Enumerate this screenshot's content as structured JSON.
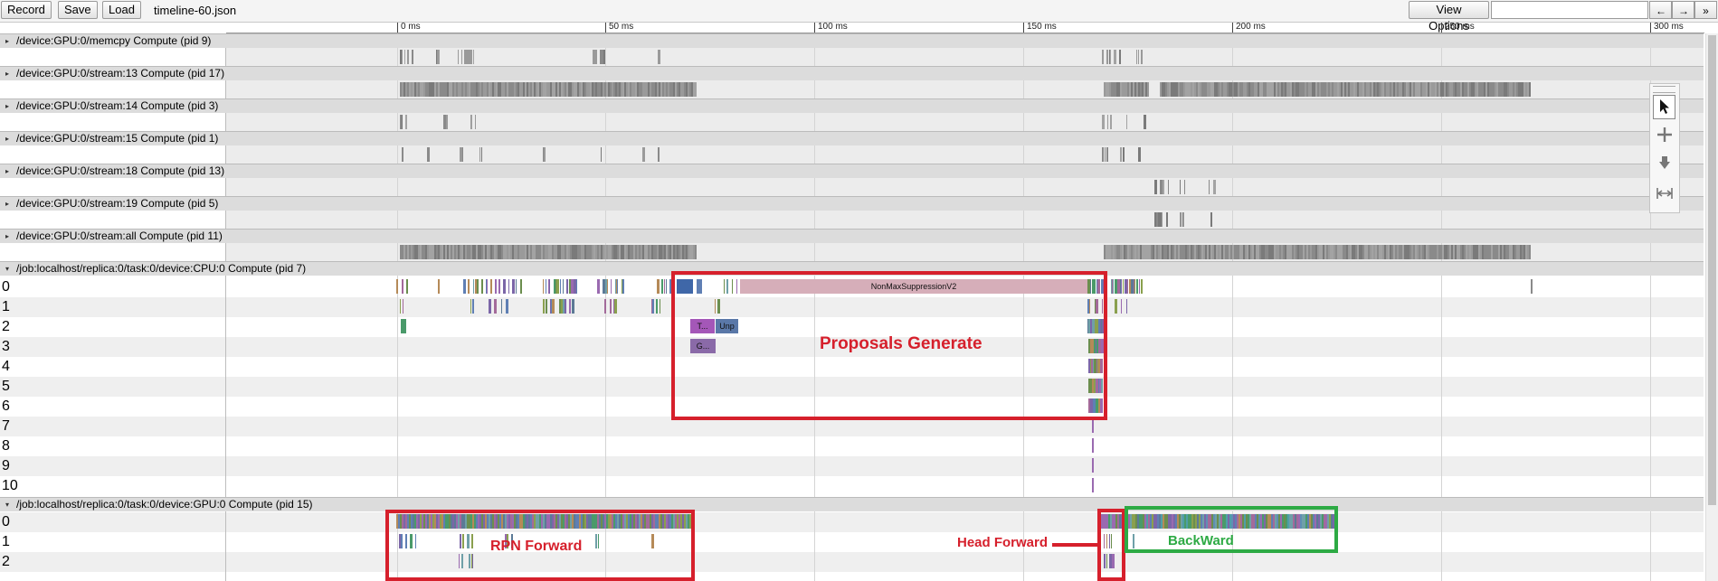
{
  "toolbar": {
    "record_label": "Record",
    "save_label": "Save",
    "load_label": "Load",
    "filename": "timeline-60.json",
    "view_options_label": "View Options",
    "nav_back": "←",
    "nav_forward": "→",
    "nav_more": "»"
  },
  "ruler": {
    "ticks": [
      "0 ms",
      "50 ms",
      "100 ms",
      "150 ms",
      "200 ms",
      "250 ms",
      "300 ms"
    ]
  },
  "processes": {
    "memcpy": "/device:GPU:0/memcpy Compute (pid 9)",
    "stream13": "/device:GPU:0/stream:13 Compute (pid 17)",
    "stream14": "/device:GPU:0/stream:14 Compute (pid 3)",
    "stream15": "/device:GPU:0/stream:15 Compute (pid 1)",
    "stream18": "/device:GPU:0/stream:18 Compute (pid 13)",
    "stream19": "/device:GPU:0/stream:19 Compute (pid 5)",
    "streamall": "/device:GPU:0/stream:all Compute (pid 11)",
    "cpu": "/job:localhost/replica:0/task:0/device:CPU:0 Compute (pid 7)",
    "gpu": "/job:localhost/replica:0/task:0/device:GPU:0 Compute (pid 15)"
  },
  "cpu_threads": [
    "0",
    "1",
    "2",
    "3",
    "4",
    "5",
    "6",
    "7",
    "8",
    "9",
    "10"
  ],
  "gpu_threads": [
    "0",
    "1",
    "2"
  ],
  "slices": {
    "nms": "NonMaxSuppressionV2",
    "t": "T...",
    "unp": "Unp",
    "g": "G..."
  },
  "annotations": {
    "proposals": "Proposals Generate",
    "rpn": "RPN Forward",
    "head": "Head Forward",
    "backward": "BackWard"
  },
  "colors": {
    "annotation_red": "#d6202c",
    "annotation_green": "#2daa44",
    "nms_slice": "#d6aeb9",
    "stream_slice": "#8c8c8c"
  },
  "icons": [
    "select-cursor-icon",
    "pan-move-icon",
    "zoom-icon",
    "timing-icon",
    "expand-triangle-icon"
  ]
}
